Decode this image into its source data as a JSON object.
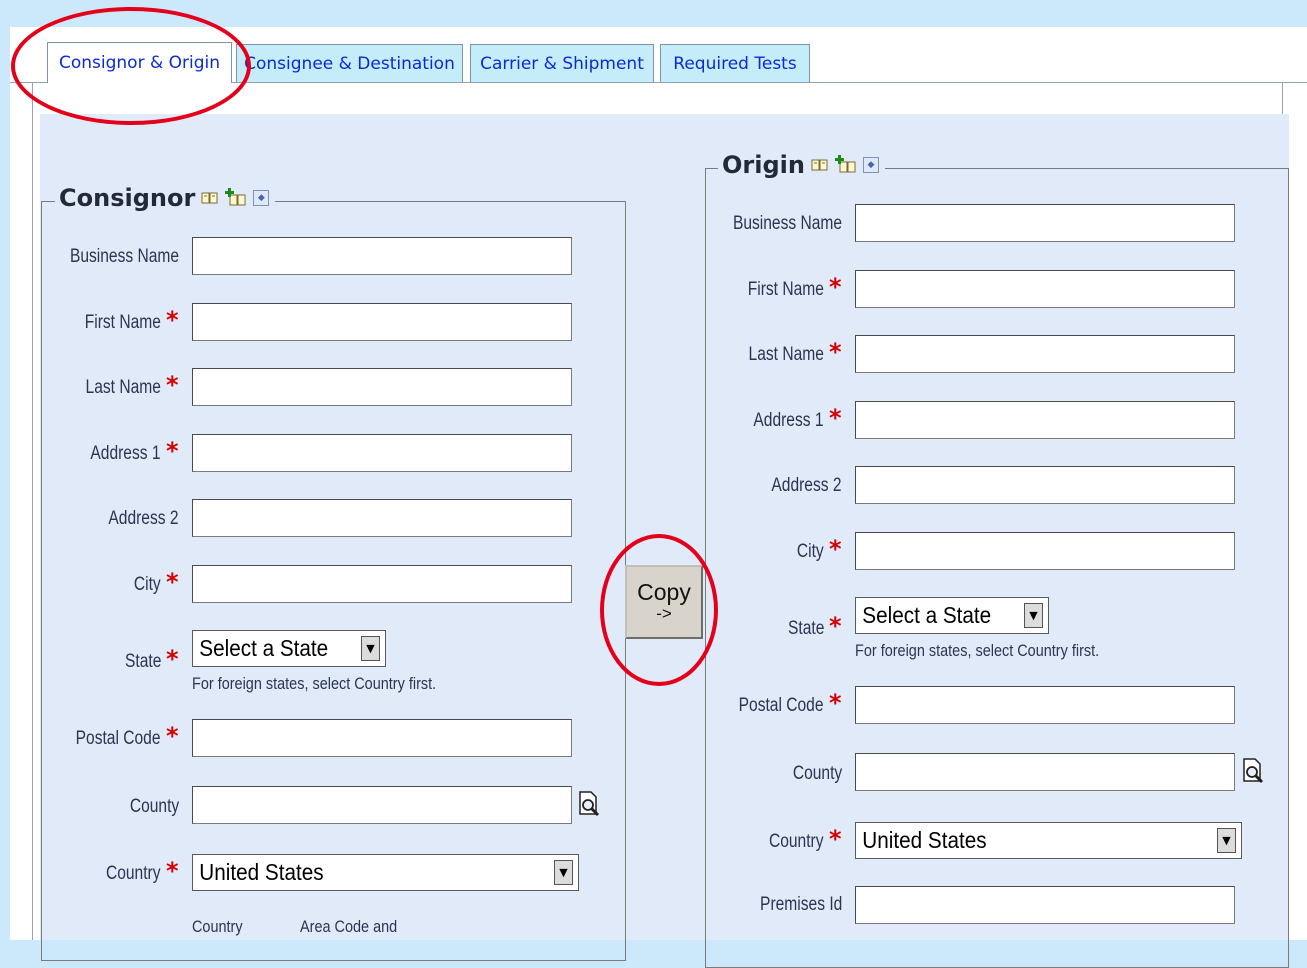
{
  "tabs": [
    {
      "label": "Consignor & Origin",
      "active": true
    },
    {
      "label": "Consignee & Destination",
      "active": false
    },
    {
      "label": "Carrier & Shipment",
      "active": false
    },
    {
      "label": "Required Tests",
      "active": false
    }
  ],
  "consignor": {
    "title": "Consignor",
    "labels": {
      "business_name": "Business Name",
      "first_name": "First Name",
      "last_name": "Last Name",
      "address1": "Address 1",
      "address2": "Address 2",
      "city": "City",
      "state": "State",
      "postal_code": "Postal Code",
      "county": "County",
      "country": "Country"
    },
    "values": {
      "business_name": "",
      "first_name": "",
      "last_name": "",
      "address1": "",
      "address2": "",
      "city": "",
      "postal_code": "",
      "county": ""
    },
    "state_selected": "Select a State",
    "state_hint": "For foreign states, select Country first.",
    "country_selected": "United States",
    "phone_headers": {
      "country": "Country",
      "area": "Area Code and"
    }
  },
  "origin": {
    "title": "Origin",
    "labels": {
      "business_name": "Business Name",
      "first_name": "First Name",
      "last_name": "Last Name",
      "address1": "Address 1",
      "address2": "Address 2",
      "city": "City",
      "state": "State",
      "postal_code": "Postal Code",
      "county": "County",
      "country": "Country",
      "premises_id": "Premises Id"
    },
    "values": {
      "business_name": "",
      "first_name": "",
      "last_name": "",
      "address1": "",
      "address2": "",
      "city": "",
      "postal_code": "",
      "county": "",
      "premises_id": ""
    },
    "state_selected": "Select a State",
    "state_hint": "For foreign states, select Country first.",
    "country_selected": "United States"
  },
  "copy_button": {
    "line1": "Copy",
    "line2": "->"
  },
  "required_marker": "*",
  "dropdown_arrow": "▼",
  "colors": {
    "required": "#d60000",
    "highlight": "#e4001a",
    "tab_text": "#0b2ad6",
    "panel_bg": "#e1eaf9"
  }
}
